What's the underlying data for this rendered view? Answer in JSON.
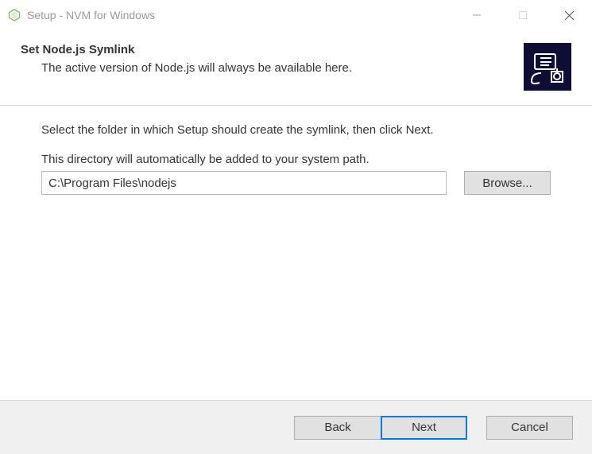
{
  "titlebar": {
    "title": "Setup - NVM for Windows"
  },
  "header": {
    "title": "Set Node.js Symlink",
    "subtitle": "The active version of Node.js will always be available here."
  },
  "content": {
    "instruction": "Select the folder in which Setup should create the symlink, then click Next.",
    "path_hint": "This directory will automatically be added to your system path.",
    "path_value": "C:\\Program Files\\nodejs",
    "browse_label": "Browse..."
  },
  "footer": {
    "back_label": "Back",
    "next_label": "Next",
    "cancel_label": "Cancel"
  }
}
